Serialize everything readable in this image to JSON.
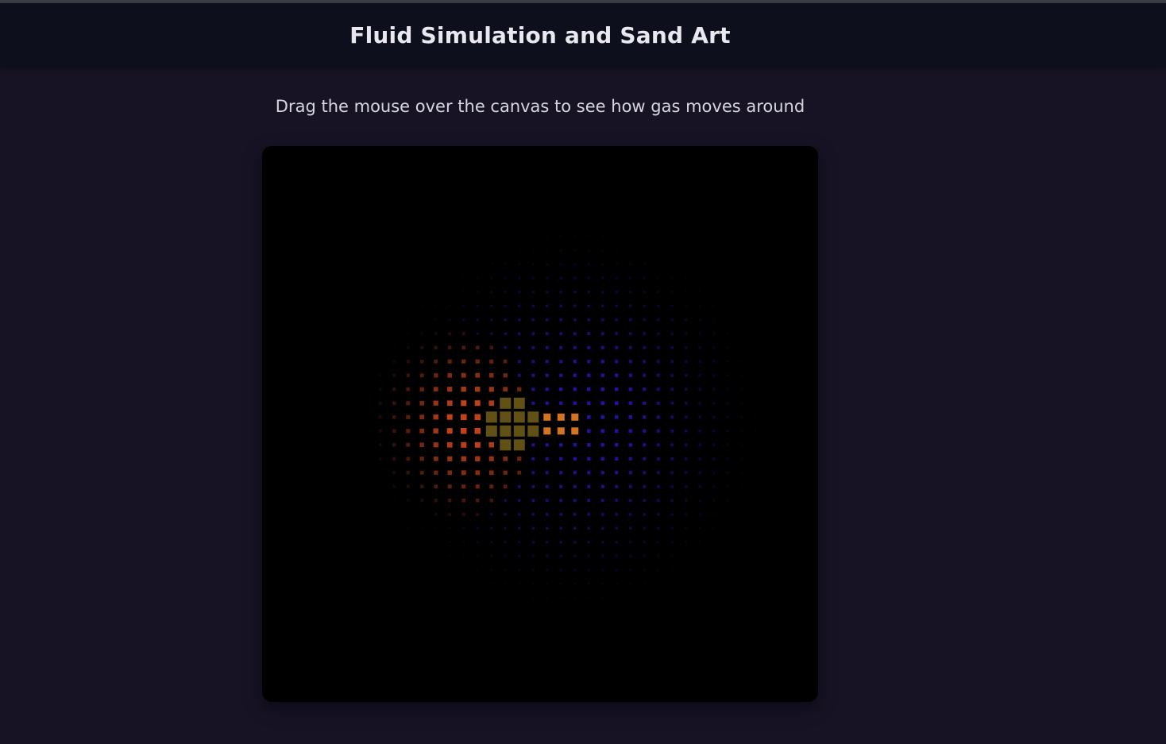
{
  "header": {
    "title": "Fluid Simulation and Sand Art"
  },
  "main": {
    "instructions": "Drag the mouse over the canvas to see how gas moves around"
  },
  "canvas": {
    "background": "#000000",
    "palette": {
      "warm": "#d8481c",
      "hot": "#e07a22",
      "center": "#6b5a18",
      "cool": "#2a1ad8"
    }
  }
}
